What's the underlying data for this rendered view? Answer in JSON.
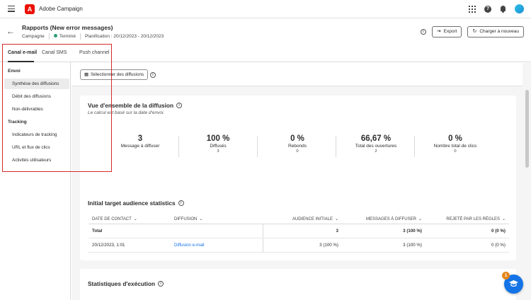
{
  "app": {
    "name": "Adobe Campaign",
    "logo_letter": "A"
  },
  "header": {
    "title": "Rapports (New error messages)",
    "type": "Campagne",
    "status": "Terminé",
    "status_color": "#2d9d78",
    "planning": "Planification : 20/12/2023 - 20/12/2023",
    "export_label": "Export",
    "reload_label": "Charger à nouveau"
  },
  "tabs": [
    {
      "label": "Canal e-mail",
      "active": true
    },
    {
      "label": "Canal SMS",
      "active": false
    },
    {
      "label": "Push channel",
      "active": false
    }
  ],
  "sidebar": {
    "sections": [
      {
        "title": "Envoi",
        "items": [
          "Synthèse des diffusions",
          "Débit des diffusions",
          "Non-délivrables"
        ]
      },
      {
        "title": "Tracking",
        "items": [
          "Indicateurs de tracking",
          "URL et flux de clics",
          "Activités utilisateurs"
        ]
      }
    ],
    "active_item": "Synthèse des diffusions"
  },
  "toolbar": {
    "select_label": "Sélectionner des diffusions"
  },
  "overview": {
    "title": "Vue d'ensemble de la diffusion",
    "subtitle": "Le calcul est basé sur la date d'envoi.",
    "kpis": [
      {
        "value": "3",
        "label": "Message à diffuser",
        "sub": ""
      },
      {
        "value": "100 %",
        "label": "Diffusés",
        "sub": "3"
      },
      {
        "value": "0 %",
        "label": "Rebonds",
        "sub": "0"
      },
      {
        "value": "66,67 %",
        "label": "Total des ouvertures",
        "sub": "2"
      },
      {
        "value": "0 %",
        "label": "Nombre total de clics",
        "sub": "0"
      }
    ]
  },
  "audience": {
    "title": "Initial target audience statistics",
    "columns": [
      "DATE DE CONTACT",
      "DIFFUSION",
      "AUDIENCE INITIALE",
      "MESSAGES À DIFFUSER",
      "REJETÉ PAR LES RÈGLES"
    ],
    "total": {
      "label": "Total",
      "audience": "3",
      "messages": "3 (100 %)",
      "rejected": "0 (0 %)"
    },
    "rows": [
      {
        "date": "20/12/2023, 1:01",
        "delivery": "Diffusion e-mail",
        "audience": "3 (100 %)",
        "messages": "3 (100 %)",
        "rejected": "0 (0 %)"
      }
    ]
  },
  "execution": {
    "title": "Statistiques d'exécution"
  },
  "help_badge": {
    "count": "1"
  },
  "colors": {
    "accent": "#1473e6",
    "highlight": "#d22b2b",
    "brand": "#eb1000"
  }
}
